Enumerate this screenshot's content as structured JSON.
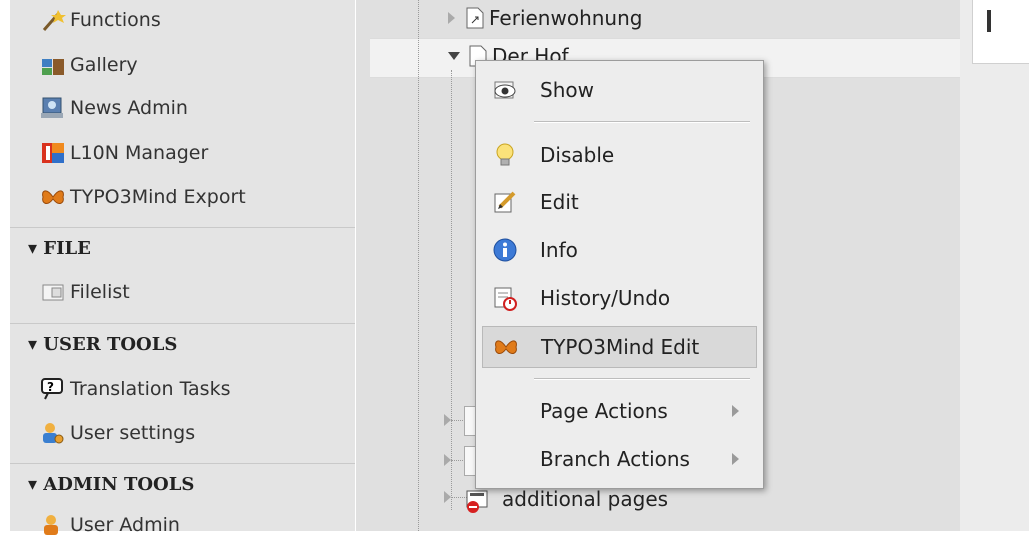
{
  "sidebar": {
    "modules_top": [
      {
        "label": "Functions",
        "icon": "wand-icon"
      },
      {
        "label": "Gallery",
        "icon": "gallery-icon"
      },
      {
        "label": "News Admin",
        "icon": "news-icon"
      },
      {
        "label": "L10N Manager",
        "icon": "l10n-icon"
      },
      {
        "label": "TYPO3Mind Export",
        "icon": "butterfly-icon"
      }
    ],
    "sections": {
      "file": {
        "title": "▾ FILE",
        "items": [
          {
            "label": "Filelist",
            "icon": "filelist-icon"
          }
        ]
      },
      "user_tools": {
        "title": "▾ USER TOOLS",
        "items": [
          {
            "label": "Translation Tasks",
            "icon": "translation-icon"
          },
          {
            "label": "User settings",
            "icon": "user-settings-icon"
          }
        ]
      },
      "admin_tools": {
        "title": "▾ ADMIN TOOLS",
        "items": [
          {
            "label": "User Admin",
            "icon": "user-admin-icon"
          }
        ]
      }
    }
  },
  "tree": {
    "nodes": [
      {
        "label": "Ferienwohnung",
        "icon": "page-link-icon"
      },
      {
        "label": "Der Hof",
        "icon": "page-link-icon"
      },
      {
        "label": "additional pages",
        "icon": "folder-restricted-icon"
      }
    ]
  },
  "context_menu": {
    "items": [
      {
        "label": "Show",
        "icon": "show-icon"
      },
      {
        "label": "Disable",
        "icon": "bulb-icon"
      },
      {
        "label": "Edit",
        "icon": "edit-icon"
      },
      {
        "label": "Info",
        "icon": "info-icon"
      },
      {
        "label": "History/Undo",
        "icon": "history-icon"
      },
      {
        "label": "TYPO3Mind Edit",
        "icon": "butterfly-icon",
        "highlighted": true
      },
      {
        "label": "Page Actions",
        "submenu": true
      },
      {
        "label": "Branch Actions",
        "submenu": true
      }
    ]
  },
  "colors": {
    "accent_butterfly": "#e07b1a",
    "menu_bg": "#ededed",
    "sidebar_bg": "#e4e4e4"
  }
}
